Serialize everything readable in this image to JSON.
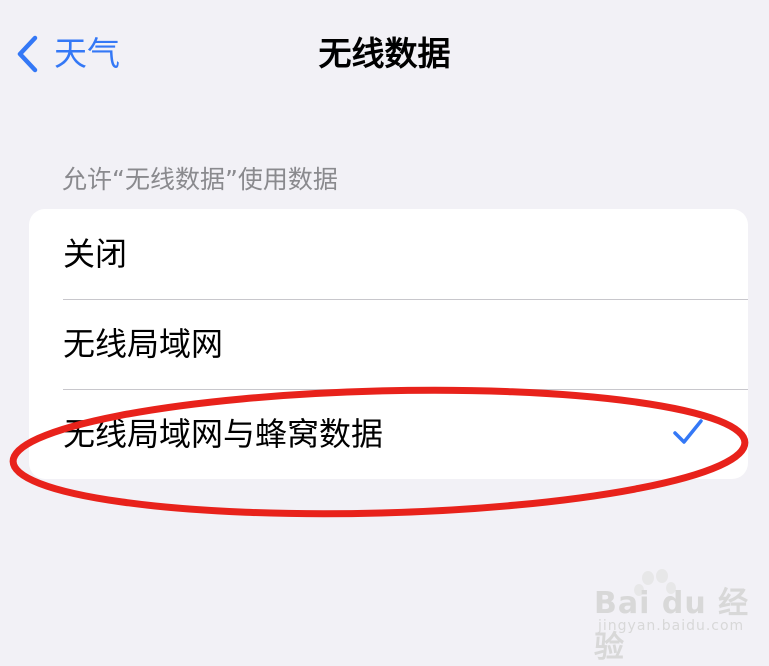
{
  "nav": {
    "back_label": "天气",
    "title": "无线数据"
  },
  "section": {
    "header": "允许“无线数据”使用数据"
  },
  "options": [
    {
      "label": "关闭",
      "selected": false
    },
    {
      "label": "无线局域网",
      "selected": false
    },
    {
      "label": "无线局域网与蜂窝数据",
      "selected": true
    }
  ],
  "colors": {
    "background": "#f2f1f6",
    "accent": "#3478f6",
    "annotation": "#e8221b"
  },
  "icons": {
    "back": "chevron-left-icon",
    "selected": "checkmark-icon"
  },
  "watermark": {
    "brand": "Bai du 经验",
    "url": "jingyan.baidu.com"
  }
}
